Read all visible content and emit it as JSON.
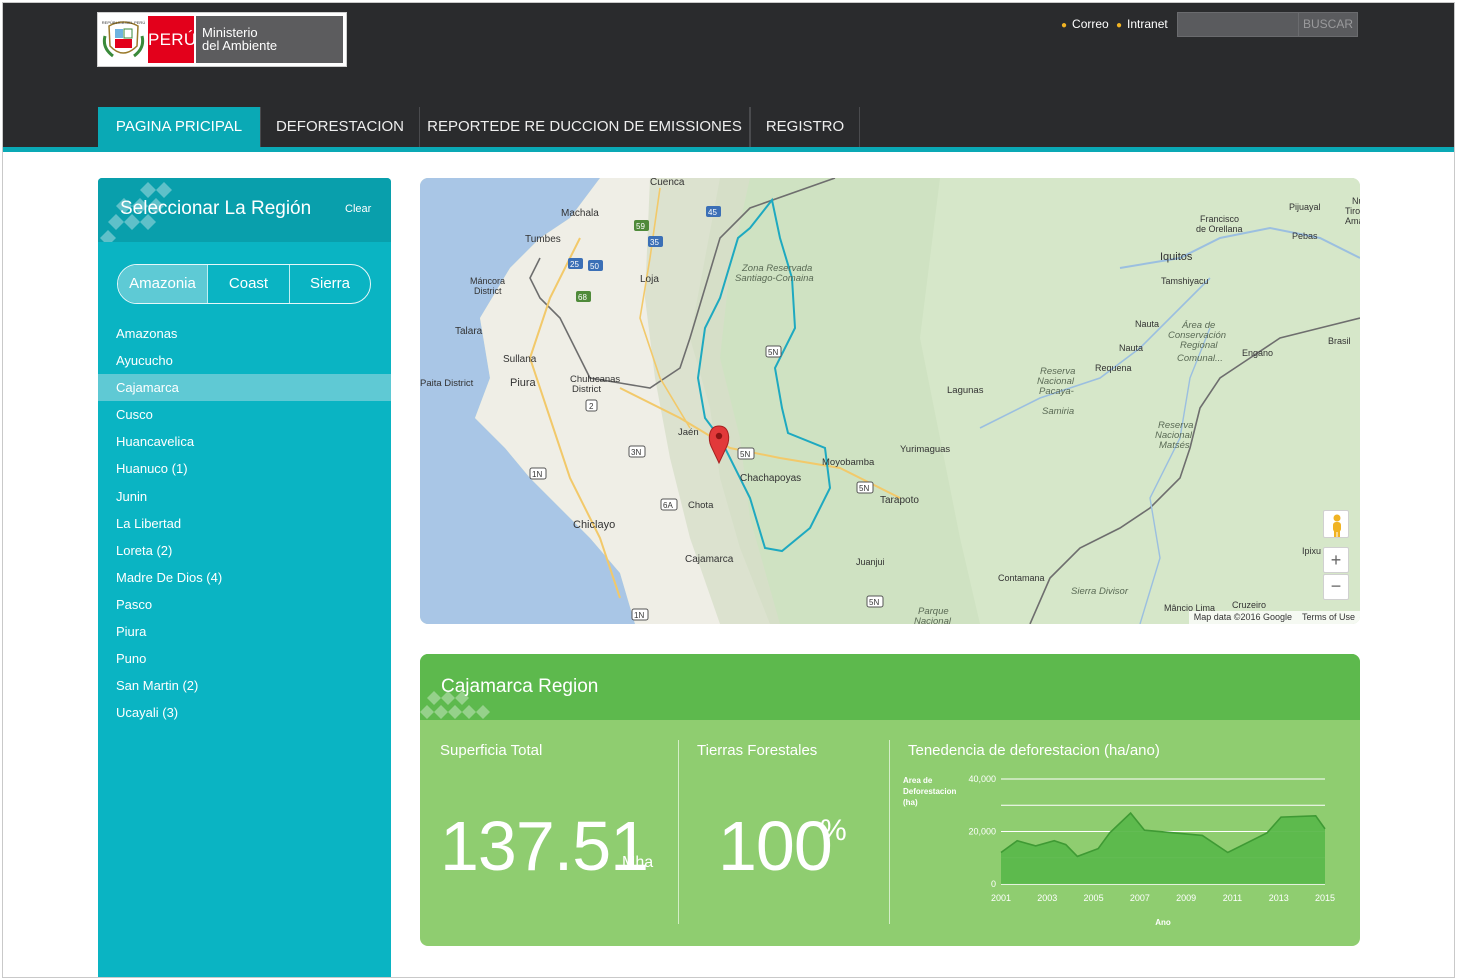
{
  "header": {
    "logo": {
      "country": "PERÚ",
      "ministry_line1": "Ministerio",
      "ministry_line2": "del Ambiente"
    },
    "links": [
      {
        "label": "Correo"
      },
      {
        "label": "Intranet"
      }
    ],
    "search": {
      "placeholder": "",
      "button_label": "BUSCAR"
    }
  },
  "nav": {
    "items": [
      {
        "label": "PAGINA PRICIPAL",
        "active": true
      },
      {
        "label": "DEFORESTACION",
        "active": false
      },
      {
        "label": "REPORTEDE RE DUCCION DE EMISSIONES",
        "active": false
      },
      {
        "label": "REGISTRO",
        "active": false
      }
    ]
  },
  "sidebar": {
    "title": "Seleccionar La Región",
    "clear_label": "Clear",
    "tabs": [
      {
        "label": "Amazonia",
        "active": true
      },
      {
        "label": "Coast",
        "active": false
      },
      {
        "label": "Sierra",
        "active": false
      }
    ],
    "regions": [
      {
        "label": "Amazonas",
        "selected": false
      },
      {
        "label": "Ayucucho",
        "selected": false
      },
      {
        "label": "Cajamarca",
        "selected": true
      },
      {
        "label": "Cusco",
        "selected": false
      },
      {
        "label": "Huancavelica",
        "selected": false
      },
      {
        "label": "Huanuco (1)",
        "selected": false
      },
      {
        "label": "Junin",
        "selected": false
      },
      {
        "label": "La Libertad",
        "selected": false
      },
      {
        "label": "Loreta (2)",
        "selected": false
      },
      {
        "label": "Madre De Dios (4)",
        "selected": false
      },
      {
        "label": "Pasco",
        "selected": false
      },
      {
        "label": "Piura",
        "selected": false
      },
      {
        "label": "Puno",
        "selected": false
      },
      {
        "label": "San Martin (2)",
        "selected": false
      },
      {
        "label": "Ucayali (3)",
        "selected": false
      }
    ]
  },
  "map": {
    "labels": [
      "Cuenca",
      "Machala",
      "Tumbes",
      "Máncora District",
      "Loja",
      "Talara",
      "Sullana",
      "Paita District",
      "Piura",
      "Chulucanas District",
      "Jaén",
      "Chota",
      "Chiclayo",
      "Cajamarca",
      "Chachapoyas",
      "Moyobamba",
      "Tarapoto",
      "Yurimaguas",
      "Lagunas",
      "Juanjui",
      "Iquitos",
      "Tamshiyacu",
      "Nauta",
      "Requena",
      "Francisco de Orellana",
      "Pijuayal",
      "Pebas",
      "Brasil",
      "Engano",
      "Contamana",
      "Sierra Divisor",
      "Mâncio Lima",
      "Cruzeiro",
      "Ipixu",
      "Zona Reservada Santiago-Comaina",
      "Reserva Nacional Pacaya-Samiria",
      "Área de Conservación Regional Comunal...",
      "Reserva Nacional Matsés",
      "Parque Nacional",
      "Nu",
      "Tiro",
      "Ama"
    ],
    "road_markers": [
      "45",
      "59",
      "35",
      "25",
      "50",
      "68",
      "5N",
      "2",
      "3N",
      "1N",
      "6A",
      "1N",
      "5N",
      "5N",
      "5N"
    ],
    "attribution": "Map data ©2016 Google",
    "terms": "Terms of Use",
    "zoom_in": "+",
    "zoom_out": "−",
    "colors": {
      "water": "#a9c6e6",
      "land": "#f1efe6",
      "forest": "#cfe2c2",
      "boundary": "#1ea9c0",
      "marker": "#e2393a"
    }
  },
  "region_card": {
    "title": "Cajamarca Region",
    "stats": [
      {
        "label": "Superficia Total",
        "value": "137.51",
        "unit": "Mha"
      },
      {
        "label": "Tierras Forestales",
        "value": "100",
        "unit": "%"
      }
    ],
    "chart_title": "Tenedencia de deforestacion (ha/ano)"
  },
  "chart_data": {
    "type": "area",
    "title": "",
    "xlabel": "Ano",
    "ylabel": "Area de Deforestacion (ha)",
    "ylim": [
      0,
      40000
    ],
    "y_ticks": [
      0,
      20000,
      40000
    ],
    "y_tick_labels": [
      "0",
      "20,000",
      "40,000"
    ],
    "x_ticks": [
      2001,
      2003,
      2005,
      2007,
      2009,
      2011,
      2013,
      2015
    ],
    "grid": true,
    "x": [
      2001,
      2001.7,
      2002.5,
      2003.3,
      2003.8,
      2004.3,
      2005.2,
      2005.7,
      2006.6,
      2007.2,
      2009.7,
      2010.8,
      2012.5,
      2013.1,
      2014.6,
      2015
    ],
    "series": [
      {
        "values": [
          12000,
          16500,
          14500,
          16500,
          15000,
          10500,
          13500,
          19500,
          27000,
          20500,
          18500,
          12000,
          19500,
          25500,
          26000,
          21000
        ]
      }
    ],
    "fill_color": "#5bb84b",
    "line_color": "#3f9a34"
  }
}
